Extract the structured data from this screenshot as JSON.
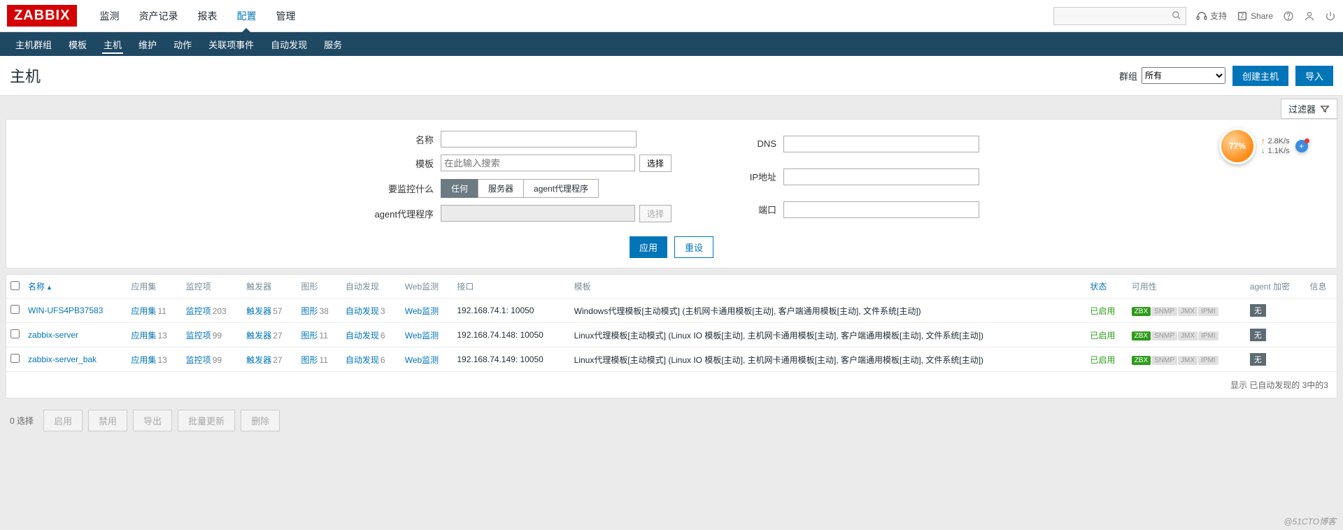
{
  "brand": "ZABBIX",
  "topnav": {
    "items": [
      "监测",
      "资产记录",
      "报表",
      "配置",
      "管理"
    ],
    "active_index": 3
  },
  "topright": {
    "support": "支持",
    "share": "Share"
  },
  "subnav": {
    "items": [
      "主机群组",
      "模板",
      "主机",
      "维护",
      "动作",
      "关联项事件",
      "自动发现",
      "服务"
    ],
    "active_index": 2
  },
  "page": {
    "title": "主机",
    "group_label": "群组",
    "group_value": "所有",
    "create_btn": "创建主机",
    "import_btn": "导入"
  },
  "filter_tab": "过滤器",
  "filter": {
    "name_label": "名称",
    "template_label": "模板",
    "template_placeholder": "在此输入搜索",
    "select_btn": "选择",
    "monitored_label": "要监控什么",
    "monitored_opts": [
      "任何",
      "服务器",
      "agent代理程序"
    ],
    "monitored_active": 0,
    "proxy_label": "agent代理程序",
    "dns_label": "DNS",
    "ip_label": "IP地址",
    "port_label": "端口",
    "apply_btn": "应用",
    "reset_btn": "重设"
  },
  "gauge": {
    "pct": "77%",
    "up": "2.8K/s",
    "down": "1.1K/s"
  },
  "table": {
    "headers": {
      "name": "名称",
      "apps": "应用集",
      "items": "监控项",
      "triggers": "触发器",
      "graphs": "图形",
      "discovery": "自动发现",
      "web": "Web监测",
      "iface": "接口",
      "templates": "模板",
      "status": "状态",
      "avail": "可用性",
      "agentenc": "agent 加密",
      "info": "信息"
    },
    "rows": [
      {
        "name": "WIN-UFS4PB37583",
        "apps": "应用集",
        "apps_n": "11",
        "items": "监控项",
        "items_n": "203",
        "triggers": "触发器",
        "triggers_n": "57",
        "graphs": "图形",
        "graphs_n": "38",
        "discovery": "自动发现",
        "discovery_n": "3",
        "web": "Web监测",
        "iface": "192.168.74.1: 10050",
        "tpl": "Windows代理模板[主动模式] (主机网卡通用模板[主动], 客户端通用模板[主动], 文件系统[主动])",
        "status": "已启用",
        "enc": "无"
      },
      {
        "name": "zabbix-server",
        "apps": "应用集",
        "apps_n": "13",
        "items": "监控项",
        "items_n": "99",
        "triggers": "触发器",
        "triggers_n": "27",
        "graphs": "图形",
        "graphs_n": "11",
        "discovery": "自动发现",
        "discovery_n": "6",
        "web": "Web监测",
        "iface": "192.168.74.148: 10050",
        "tpl": "Linux代理模板[主动模式] (Linux IO 模板[主动], 主机网卡通用模板[主动], 客户端通用模板[主动], 文件系统[主动])",
        "status": "已启用",
        "enc": "无"
      },
      {
        "name": "zabbix-server_bak",
        "apps": "应用集",
        "apps_n": "13",
        "items": "监控项",
        "items_n": "99",
        "triggers": "触发器",
        "triggers_n": "27",
        "graphs": "图形",
        "graphs_n": "11",
        "discovery": "自动发现",
        "discovery_n": "6",
        "web": "Web监测",
        "iface": "192.168.74.149: 10050",
        "tpl": "Linux代理模板[主动模式] (Linux IO 模板[主动], 主机网卡通用模板[主动], 客户端通用模板[主动], 文件系统[主动])",
        "status": "已启用",
        "enc": "无"
      }
    ],
    "footer": "显示 已自动发现的 3中的3"
  },
  "bulk": {
    "selected": "0 选择",
    "enable": "启用",
    "disable": "禁用",
    "export": "导出",
    "massupdate": "批量更新",
    "delete": "删除"
  },
  "watermark": "@51CTO博客"
}
